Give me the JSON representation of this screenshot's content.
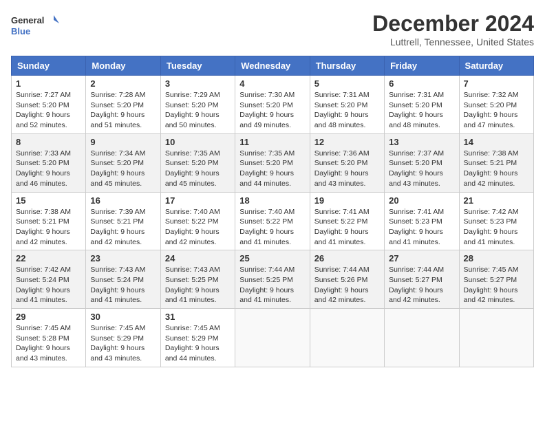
{
  "header": {
    "logo_line1": "General",
    "logo_line2": "Blue",
    "month": "December 2024",
    "location": "Luttrell, Tennessee, United States"
  },
  "weekdays": [
    "Sunday",
    "Monday",
    "Tuesday",
    "Wednesday",
    "Thursday",
    "Friday",
    "Saturday"
  ],
  "weeks": [
    [
      {
        "day": "1",
        "sunrise": "Sunrise: 7:27 AM",
        "sunset": "Sunset: 5:20 PM",
        "daylight": "Daylight: 9 hours and 52 minutes."
      },
      {
        "day": "2",
        "sunrise": "Sunrise: 7:28 AM",
        "sunset": "Sunset: 5:20 PM",
        "daylight": "Daylight: 9 hours and 51 minutes."
      },
      {
        "day": "3",
        "sunrise": "Sunrise: 7:29 AM",
        "sunset": "Sunset: 5:20 PM",
        "daylight": "Daylight: 9 hours and 50 minutes."
      },
      {
        "day": "4",
        "sunrise": "Sunrise: 7:30 AM",
        "sunset": "Sunset: 5:20 PM",
        "daylight": "Daylight: 9 hours and 49 minutes."
      },
      {
        "day": "5",
        "sunrise": "Sunrise: 7:31 AM",
        "sunset": "Sunset: 5:20 PM",
        "daylight": "Daylight: 9 hours and 48 minutes."
      },
      {
        "day": "6",
        "sunrise": "Sunrise: 7:31 AM",
        "sunset": "Sunset: 5:20 PM",
        "daylight": "Daylight: 9 hours and 48 minutes."
      },
      {
        "day": "7",
        "sunrise": "Sunrise: 7:32 AM",
        "sunset": "Sunset: 5:20 PM",
        "daylight": "Daylight: 9 hours and 47 minutes."
      }
    ],
    [
      {
        "day": "8",
        "sunrise": "Sunrise: 7:33 AM",
        "sunset": "Sunset: 5:20 PM",
        "daylight": "Daylight: 9 hours and 46 minutes."
      },
      {
        "day": "9",
        "sunrise": "Sunrise: 7:34 AM",
        "sunset": "Sunset: 5:20 PM",
        "daylight": "Daylight: 9 hours and 45 minutes."
      },
      {
        "day": "10",
        "sunrise": "Sunrise: 7:35 AM",
        "sunset": "Sunset: 5:20 PM",
        "daylight": "Daylight: 9 hours and 45 minutes."
      },
      {
        "day": "11",
        "sunrise": "Sunrise: 7:35 AM",
        "sunset": "Sunset: 5:20 PM",
        "daylight": "Daylight: 9 hours and 44 minutes."
      },
      {
        "day": "12",
        "sunrise": "Sunrise: 7:36 AM",
        "sunset": "Sunset: 5:20 PM",
        "daylight": "Daylight: 9 hours and 43 minutes."
      },
      {
        "day": "13",
        "sunrise": "Sunrise: 7:37 AM",
        "sunset": "Sunset: 5:20 PM",
        "daylight": "Daylight: 9 hours and 43 minutes."
      },
      {
        "day": "14",
        "sunrise": "Sunrise: 7:38 AM",
        "sunset": "Sunset: 5:21 PM",
        "daylight": "Daylight: 9 hours and 42 minutes."
      }
    ],
    [
      {
        "day": "15",
        "sunrise": "Sunrise: 7:38 AM",
        "sunset": "Sunset: 5:21 PM",
        "daylight": "Daylight: 9 hours and 42 minutes."
      },
      {
        "day": "16",
        "sunrise": "Sunrise: 7:39 AM",
        "sunset": "Sunset: 5:21 PM",
        "daylight": "Daylight: 9 hours and 42 minutes."
      },
      {
        "day": "17",
        "sunrise": "Sunrise: 7:40 AM",
        "sunset": "Sunset: 5:22 PM",
        "daylight": "Daylight: 9 hours and 42 minutes."
      },
      {
        "day": "18",
        "sunrise": "Sunrise: 7:40 AM",
        "sunset": "Sunset: 5:22 PM",
        "daylight": "Daylight: 9 hours and 41 minutes."
      },
      {
        "day": "19",
        "sunrise": "Sunrise: 7:41 AM",
        "sunset": "Sunset: 5:22 PM",
        "daylight": "Daylight: 9 hours and 41 minutes."
      },
      {
        "day": "20",
        "sunrise": "Sunrise: 7:41 AM",
        "sunset": "Sunset: 5:23 PM",
        "daylight": "Daylight: 9 hours and 41 minutes."
      },
      {
        "day": "21",
        "sunrise": "Sunrise: 7:42 AM",
        "sunset": "Sunset: 5:23 PM",
        "daylight": "Daylight: 9 hours and 41 minutes."
      }
    ],
    [
      {
        "day": "22",
        "sunrise": "Sunrise: 7:42 AM",
        "sunset": "Sunset: 5:24 PM",
        "daylight": "Daylight: 9 hours and 41 minutes."
      },
      {
        "day": "23",
        "sunrise": "Sunrise: 7:43 AM",
        "sunset": "Sunset: 5:24 PM",
        "daylight": "Daylight: 9 hours and 41 minutes."
      },
      {
        "day": "24",
        "sunrise": "Sunrise: 7:43 AM",
        "sunset": "Sunset: 5:25 PM",
        "daylight": "Daylight: 9 hours and 41 minutes."
      },
      {
        "day": "25",
        "sunrise": "Sunrise: 7:44 AM",
        "sunset": "Sunset: 5:25 PM",
        "daylight": "Daylight: 9 hours and 41 minutes."
      },
      {
        "day": "26",
        "sunrise": "Sunrise: 7:44 AM",
        "sunset": "Sunset: 5:26 PM",
        "daylight": "Daylight: 9 hours and 42 minutes."
      },
      {
        "day": "27",
        "sunrise": "Sunrise: 7:44 AM",
        "sunset": "Sunset: 5:27 PM",
        "daylight": "Daylight: 9 hours and 42 minutes."
      },
      {
        "day": "28",
        "sunrise": "Sunrise: 7:45 AM",
        "sunset": "Sunset: 5:27 PM",
        "daylight": "Daylight: 9 hours and 42 minutes."
      }
    ],
    [
      {
        "day": "29",
        "sunrise": "Sunrise: 7:45 AM",
        "sunset": "Sunset: 5:28 PM",
        "daylight": "Daylight: 9 hours and 43 minutes."
      },
      {
        "day": "30",
        "sunrise": "Sunrise: 7:45 AM",
        "sunset": "Sunset: 5:29 PM",
        "daylight": "Daylight: 9 hours and 43 minutes."
      },
      {
        "day": "31",
        "sunrise": "Sunrise: 7:45 AM",
        "sunset": "Sunset: 5:29 PM",
        "daylight": "Daylight: 9 hours and 44 minutes."
      },
      null,
      null,
      null,
      null
    ]
  ]
}
